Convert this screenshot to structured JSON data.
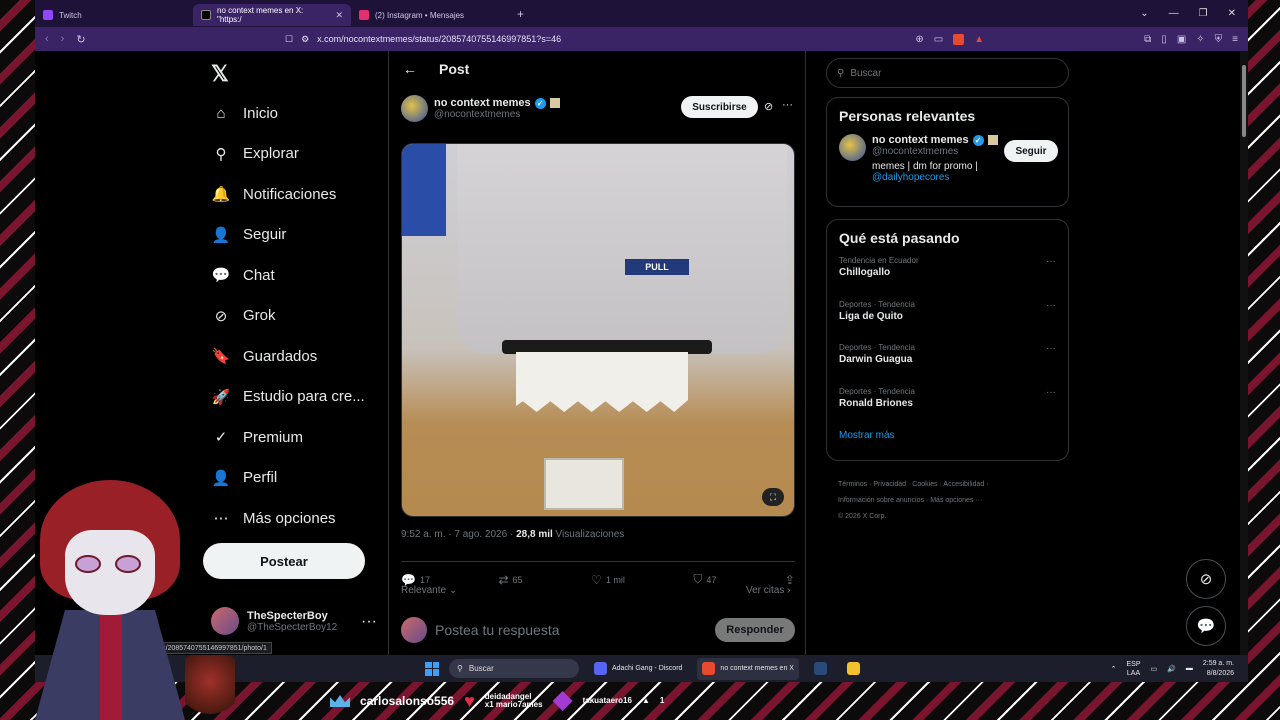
{
  "browser": {
    "tabs": [
      {
        "label": "Twitch",
        "color": "#9146ff"
      },
      {
        "label": "no context memes en X: \"https:/",
        "color": "#000000"
      },
      {
        "label": "(2) Instagram • Mensajes",
        "color": "#e1306c"
      }
    ],
    "url": "x.com/nocontextmemes/status/2085740755146997851?s=46"
  },
  "nav": {
    "logo": "𝕏",
    "items": [
      {
        "icon": "⌂",
        "label": "Inicio"
      },
      {
        "icon": "⚲",
        "label": "Explorar"
      },
      {
        "icon": "🔔",
        "label": "Notificaciones"
      },
      {
        "icon": "👤",
        "label": "Seguir"
      },
      {
        "icon": "💬",
        "label": "Chat"
      },
      {
        "icon": "⊘",
        "label": "Grok"
      },
      {
        "icon": "🔖",
        "label": "Guardados"
      },
      {
        "icon": "🚀",
        "label": "Estudio para cre..."
      },
      {
        "icon": "✓",
        "label": "Premium"
      },
      {
        "icon": "👤",
        "label": "Perfil"
      },
      {
        "icon": "⋯",
        "label": "Más opciones"
      }
    ],
    "post_button": "Postear",
    "user": {
      "name": "TheSpecterBoy",
      "handle": "@TheSpecterBoy12"
    }
  },
  "post": {
    "header_title": "Post",
    "author_name": "no context memes",
    "author_handle": "@nocontextmemes",
    "subscribe_label": "Suscribirse",
    "media_sign": "PULL",
    "time": "9:52 a. m. · 7 ago. 2026 · ",
    "views_count": "28,8 mil",
    "views_label": " Visualizaciones",
    "stats": {
      "replies": "17",
      "reposts": "65",
      "likes": "1 mil",
      "bookmarks": "47"
    },
    "sort_label": "Relevante",
    "quotes_label": "Ver citas",
    "reply_placeholder": "Postea tu respuesta",
    "reply_button": "Responder"
  },
  "sidebar": {
    "search_placeholder": "Buscar",
    "relevant_title": "Personas relevantes",
    "relevant": {
      "name": "no context memes",
      "handle": "@nocontextmemes",
      "bio": "memes | dm for promo |",
      "bio_link": "@dailyhopecores",
      "follow_label": "Seguir"
    },
    "trends_title": "Qué está pasando",
    "trends": [
      {
        "context": "Tendencia en Ecuador",
        "name": "Chillogallo"
      },
      {
        "context": "Deportes · Tendencia",
        "name": "Liga de Quito"
      },
      {
        "context": "Deportes · Tendencia",
        "name": "Darwin Guagua"
      },
      {
        "context": "Deportes · Tendencia",
        "name": "Ronald Briones"
      }
    ],
    "show_more": "Mostrar más",
    "footer_line1": "Términos · Privacidad · Cookies · Accesibilidad ·",
    "footer_line2": "Información sobre anuncios · Más opciones ···",
    "footer_line3": "© 2026 X Corp."
  },
  "status_url": "/status/2085740755146997851/photo/1",
  "taskbar": {
    "search": "Buscar",
    "apps": [
      {
        "label": "Adachi Gang - Discord",
        "color": "#5865f2"
      },
      {
        "label": "no context memes en X",
        "color": "#e84a2f"
      }
    ],
    "lang_top": "ESP",
    "lang_bottom": "LAA",
    "time": "2:59 a. m.",
    "date": "8/8/2026"
  },
  "stream_overlay": {
    "user1": "carlosalonso556",
    "user2_top": "deidadangel",
    "user2_bottom": "x1 mario7ames",
    "user3": "takuataero16",
    "user3_count": "1"
  }
}
